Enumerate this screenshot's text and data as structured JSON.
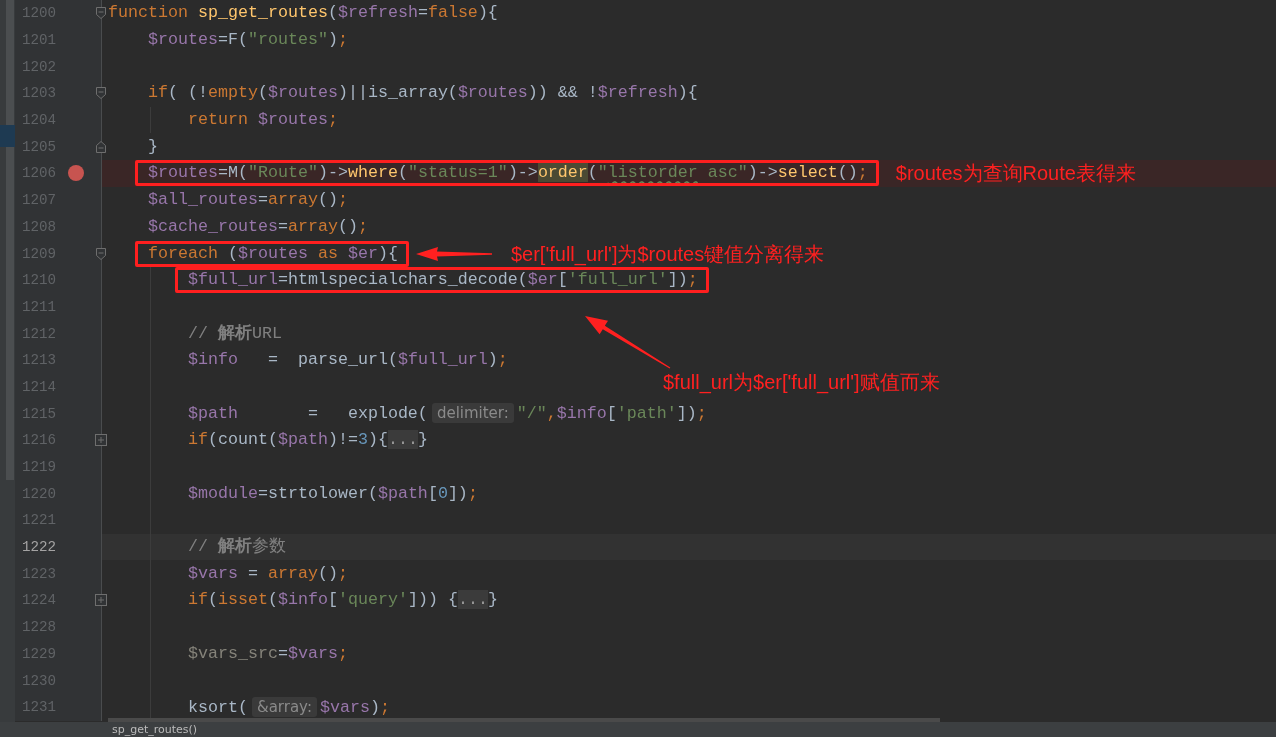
{
  "editor": {
    "lines": [
      {
        "number": "1200",
        "fold_start": true,
        "tokens": [
          {
            "kind": "keyword",
            "text": "function "
          },
          {
            "kind": "function",
            "text": "sp_get_routes"
          },
          {
            "kind": "plain",
            "text": "("
          },
          {
            "kind": "variable",
            "text": "$refresh"
          },
          {
            "kind": "plain",
            "text": "="
          },
          {
            "kind": "keyword",
            "text": "false"
          },
          {
            "kind": "plain",
            "text": "){"
          }
        ]
      },
      {
        "number": "1201",
        "tokens": [
          {
            "kind": "variable",
            "text": "    $routes"
          },
          {
            "kind": "plain",
            "text": "=F("
          },
          {
            "kind": "string",
            "text": "\"routes\""
          },
          {
            "kind": "plain",
            "text": ")"
          },
          {
            "kind": "punctuation",
            "text": ";"
          }
        ]
      },
      {
        "number": "1202"
      },
      {
        "number": "1203",
        "fold_start": true,
        "tokens": [
          {
            "kind": "keyword",
            "text": "    if"
          },
          {
            "kind": "plain",
            "text": "( (!"
          },
          {
            "kind": "keyword",
            "text": "empty"
          },
          {
            "kind": "plain",
            "text": "("
          },
          {
            "kind": "variable",
            "text": "$routes"
          },
          {
            "kind": "plain",
            "text": ")||is_array("
          },
          {
            "kind": "variable",
            "text": "$routes"
          },
          {
            "kind": "plain",
            "text": ")) && !"
          },
          {
            "kind": "variable",
            "text": "$refresh"
          },
          {
            "kind": "plain",
            "text": "){"
          }
        ]
      },
      {
        "number": "1204",
        "tokens": [
          {
            "kind": "keyword",
            "text": "        return "
          },
          {
            "kind": "variable",
            "text": "$routes"
          },
          {
            "kind": "punctuation",
            "text": ";"
          }
        ]
      },
      {
        "number": "1205",
        "fold_end": true,
        "tokens": [
          {
            "kind": "plain",
            "text": "    }"
          }
        ]
      },
      {
        "number": "1206",
        "breakpoint": true,
        "boxed": true,
        "tokens": [
          {
            "kind": "variable",
            "text": "    $routes"
          },
          {
            "kind": "plain",
            "text": "=M("
          },
          {
            "kind": "string",
            "text": "\"Route\""
          },
          {
            "kind": "plain",
            "text": ")->"
          },
          {
            "kind": "method",
            "text": "where"
          },
          {
            "kind": "plain",
            "text": "("
          },
          {
            "kind": "string",
            "text": "\"status=1\""
          },
          {
            "kind": "plain",
            "text": ")->"
          },
          {
            "kind": "method",
            "text": "order",
            "highlighted": true
          },
          {
            "kind": "plain",
            "text": "("
          },
          {
            "kind": "string",
            "text": "\""
          },
          {
            "kind": "string",
            "text": "listorder",
            "typo": true
          },
          {
            "kind": "string",
            "text": " asc\""
          },
          {
            "kind": "plain",
            "text": ")->"
          },
          {
            "kind": "method",
            "text": "select"
          },
          {
            "kind": "plain",
            "text": "()"
          },
          {
            "kind": "punctuation",
            "text": ";"
          }
        ],
        "note": {
          "kind": "inline",
          "text": "$routes为查询Route表得来"
        }
      },
      {
        "number": "1207",
        "tokens": [
          {
            "kind": "variable",
            "text": "    $all_routes"
          },
          {
            "kind": "plain",
            "text": "="
          },
          {
            "kind": "keyword",
            "text": "array"
          },
          {
            "kind": "plain",
            "text": "()"
          },
          {
            "kind": "punctuation",
            "text": ";"
          }
        ]
      },
      {
        "number": "1208",
        "tokens": [
          {
            "kind": "variable",
            "text": "    $cache_routes"
          },
          {
            "kind": "plain",
            "text": "="
          },
          {
            "kind": "keyword",
            "text": "array"
          },
          {
            "kind": "plain",
            "text": "()"
          },
          {
            "kind": "punctuation",
            "text": ";"
          }
        ]
      },
      {
        "number": "1209",
        "fold_start": true,
        "boxed": true,
        "tokens": [
          {
            "kind": "keyword",
            "text": "    foreach"
          },
          {
            "kind": "plain",
            "text": " ("
          },
          {
            "kind": "variable",
            "text": "$routes "
          },
          {
            "kind": "keyword",
            "text": "as "
          },
          {
            "kind": "variable",
            "text": "$er"
          },
          {
            "kind": "plain",
            "text": "){"
          }
        ],
        "note": {
          "kind": "left",
          "text": "$er['full_url']为$routes键值分离得来"
        }
      },
      {
        "number": "1210",
        "boxed": true,
        "tokens": [
          {
            "kind": "variable",
            "text": "        $full_url"
          },
          {
            "kind": "plain",
            "text": "=htmlspecialchars_decode("
          },
          {
            "kind": "variable",
            "text": "$er"
          },
          {
            "kind": "plain",
            "text": "["
          },
          {
            "kind": "string",
            "text": "'full_url'"
          },
          {
            "kind": "plain",
            "text": "])"
          },
          {
            "kind": "punctuation",
            "text": ";"
          }
        ]
      },
      {
        "number": "1211"
      },
      {
        "number": "1212",
        "tokens": [
          {
            "kind": "comment",
            "text": "        // **解析**URL"
          }
        ]
      },
      {
        "number": "1213",
        "tokens": [
          {
            "kind": "variable",
            "text": "        $info"
          },
          {
            "kind": "plain",
            "text": "   =  parse_url("
          },
          {
            "kind": "variable",
            "text": "$full_url"
          },
          {
            "kind": "plain",
            "text": ")"
          },
          {
            "kind": "punctuation",
            "text": ";"
          }
        ]
      },
      {
        "number": "1214",
        "note": {
          "kind": "diagonal",
          "text": "$full_url为$er['full_url']赋值而来"
        }
      },
      {
        "number": "1215",
        "tokens": [
          {
            "kind": "variable",
            "text": "        $path"
          },
          {
            "kind": "plain",
            "text": "       =   explode("
          },
          {
            "kind": "hint",
            "text": "delimiter:"
          },
          {
            "kind": "string",
            "text": "\"/\""
          },
          {
            "kind": "punctuation",
            "text": ","
          },
          {
            "kind": "variable",
            "text": "$info"
          },
          {
            "kind": "plain",
            "text": "["
          },
          {
            "kind": "string",
            "text": "'path'"
          },
          {
            "kind": "plain",
            "text": "])"
          },
          {
            "kind": "punctuation",
            "text": ";"
          }
        ]
      },
      {
        "number": "1216",
        "collapsed": true,
        "tokens": [
          {
            "kind": "keyword",
            "text": "        if"
          },
          {
            "kind": "plain",
            "text": "(count("
          },
          {
            "kind": "variable",
            "text": "$path"
          },
          {
            "kind": "plain",
            "text": ")!="
          },
          {
            "kind": "number",
            "text": "3"
          },
          {
            "kind": "plain",
            "text": "){"
          },
          {
            "kind": "folded",
            "text": "..."
          },
          {
            "kind": "plain",
            "text": "}"
          }
        ]
      },
      {
        "number": "1219"
      },
      {
        "number": "1220",
        "tokens": [
          {
            "kind": "variable",
            "text": "        $module"
          },
          {
            "kind": "plain",
            "text": "=strtolower("
          },
          {
            "kind": "variable",
            "text": "$path"
          },
          {
            "kind": "plain",
            "text": "["
          },
          {
            "kind": "number",
            "text": "0"
          },
          {
            "kind": "plain",
            "text": "])"
          },
          {
            "kind": "punctuation",
            "text": ";"
          }
        ]
      },
      {
        "number": "1221"
      },
      {
        "number": "1222",
        "current": true,
        "tokens": [
          {
            "kind": "comment",
            "text": "        // **解析**参数"
          }
        ]
      },
      {
        "number": "1223",
        "tokens": [
          {
            "kind": "variable",
            "text": "        $vars"
          },
          {
            "kind": "plain",
            "text": " = "
          },
          {
            "kind": "keyword",
            "text": "array"
          },
          {
            "kind": "plain",
            "text": "()"
          },
          {
            "kind": "punctuation",
            "text": ";"
          }
        ]
      },
      {
        "number": "1224",
        "collapsed": true,
        "tokens": [
          {
            "kind": "keyword",
            "text": "        if"
          },
          {
            "kind": "plain",
            "text": "("
          },
          {
            "kind": "keyword",
            "text": "isset"
          },
          {
            "kind": "plain",
            "text": "("
          },
          {
            "kind": "variable",
            "text": "$info"
          },
          {
            "kind": "plain",
            "text": "["
          },
          {
            "kind": "string",
            "text": "'query'"
          },
          {
            "kind": "plain",
            "text": "])) {"
          },
          {
            "kind": "folded",
            "text": "..."
          },
          {
            "kind": "plain",
            "text": "}"
          }
        ]
      },
      {
        "number": "1228"
      },
      {
        "number": "1229",
        "tokens": [
          {
            "kind": "unused",
            "text": "        $vars_src"
          },
          {
            "kind": "plain",
            "text": "="
          },
          {
            "kind": "variable",
            "text": "$vars"
          },
          {
            "kind": "punctuation",
            "text": ";"
          }
        ]
      },
      {
        "number": "1230"
      },
      {
        "number": "1231",
        "tokens": [
          {
            "kind": "plain",
            "text": "        ksort("
          },
          {
            "kind": "hint",
            "text": "&array:"
          },
          {
            "kind": "variable",
            "text": "$vars"
          },
          {
            "kind": "plain",
            "text": ")"
          },
          {
            "kind": "punctuation",
            "text": ";"
          }
        ]
      }
    ]
  },
  "status_bar": {
    "breadcrumb": "sp_get_routes()"
  }
}
